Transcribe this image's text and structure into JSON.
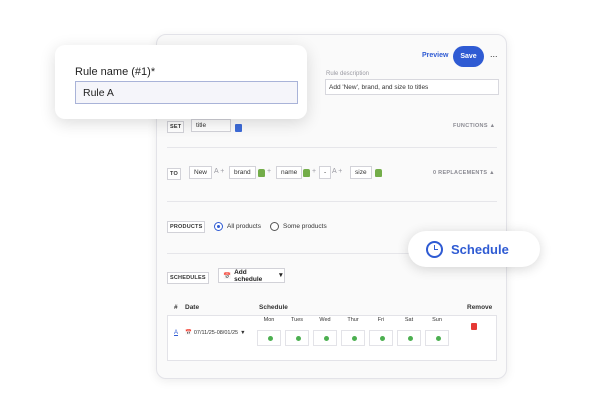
{
  "header": {
    "preview_label": "Preview",
    "save_label": "Save",
    "more_label": "..."
  },
  "rule_name": {
    "label": "Rule name (#1)*",
    "value": "Rule A"
  },
  "rule_description": {
    "label": "Rule description",
    "value": "Add 'New', brand, and size to titles"
  },
  "set_section": {
    "keyword": "SET",
    "field": "title",
    "functions_label": "FUNCTIONS"
  },
  "to_section": {
    "keyword": "TO",
    "tokens": [
      "New",
      "brand",
      "name",
      "-",
      "size"
    ],
    "replacements_label": "0 REPLACEMENTS"
  },
  "products": {
    "keyword": "PRODUCTS",
    "options": [
      {
        "label": "All products",
        "selected": true
      },
      {
        "label": "Some products",
        "selected": false
      }
    ]
  },
  "schedules": {
    "keyword": "SCHEDULES",
    "add_label": "Add schedule",
    "columns": {
      "num": "#",
      "date": "Date",
      "schedule": "Schedule",
      "remove": "Remove"
    },
    "days": [
      "Mon",
      "Tues",
      "Wed",
      "Thur",
      "Fri",
      "Sat",
      "Sun"
    ],
    "row": {
      "index": "A",
      "date_range": "07/11/25-08/01/25",
      "active_days": [
        true,
        true,
        true,
        true,
        true,
        true,
        true
      ]
    }
  },
  "schedule_pill": {
    "label": "Schedule"
  },
  "colors": {
    "accent": "#2f5bd3",
    "active_dot": "#4caf50",
    "remove": "#e53935",
    "shopify_tag": "#73ad49"
  }
}
